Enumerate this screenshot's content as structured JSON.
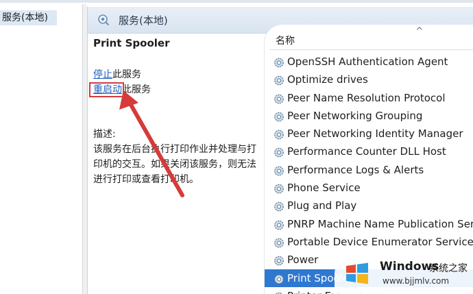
{
  "window": {
    "tree_item": "服务(本地)",
    "title": "服务(本地)",
    "title_icon": "search-gear-icon"
  },
  "detail": {
    "service_name": "Print Spooler",
    "stop_link": "停止",
    "stop_suffix": "此服务",
    "restart_link": "重启动",
    "restart_suffix": "此服务",
    "description_label": "描述:",
    "description_text": "该服务在后台执行打印作业并处理与打印机的交互。如果关闭该服务，则无法进行打印或查看打印机。"
  },
  "list": {
    "column_name": "名称",
    "sort_indicator": "^",
    "items": [
      "OpenSSH Authentication Agent",
      "Optimize drives",
      "Peer Name Resolution Protocol",
      "Peer Networking Grouping",
      "Peer Networking Identity Manager",
      "Performance Counter DLL Host",
      "Performance Logs & Alerts",
      "Phone Service",
      "Plug and Play",
      "PNRP Machine Name Publication Service",
      "Portable Device Enumerator Service",
      "Power",
      "Print Spooler",
      "Printer Extensions"
    ],
    "selected_index": 12
  },
  "annotation": {
    "color": "#d63a3a"
  },
  "watermark": {
    "brand": "Windows",
    "brand_cn": "系统之家",
    "url": "www.bjjmlv.com"
  }
}
